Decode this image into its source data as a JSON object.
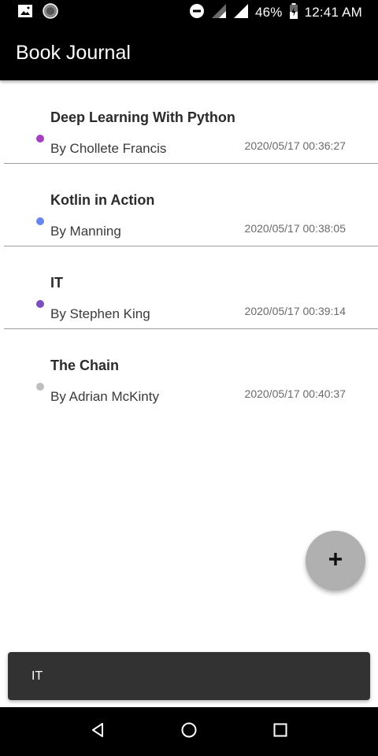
{
  "status_bar": {
    "battery_percent": "46%",
    "time": "12:41 AM",
    "left_icons": [
      "image-icon",
      "circle-notification-icon"
    ],
    "right_icons": [
      "do-not-disturb-icon",
      "signal-icon",
      "signal-icon",
      "battery-icon"
    ]
  },
  "app_bar": {
    "title": "Book Journal"
  },
  "books": [
    {
      "title": "Deep Learning With Python",
      "author": "By Chollete Francis",
      "date": "2020/05/17 00:36:27",
      "dot_color": "#a640c0"
    },
    {
      "title": "Kotlin in Action",
      "author": "By Manning",
      "date": "2020/05/17 00:38:05",
      "dot_color": "#6688ee"
    },
    {
      "title": "IT",
      "author": "By Stephen King",
      "date": "2020/05/17 00:39:14",
      "dot_color": "#7a4fc0"
    },
    {
      "title": "The Chain",
      "author": "By Adrian McKinty",
      "date": "2020/05/17 00:40:37",
      "dot_color": "#bdbdbd"
    }
  ],
  "fab": {
    "icon": "plus-icon",
    "color": "#b0b0b0"
  },
  "snackbar": {
    "message": "IT"
  },
  "nav_bar": {
    "icons": [
      "back-icon",
      "home-icon",
      "recents-icon"
    ]
  }
}
